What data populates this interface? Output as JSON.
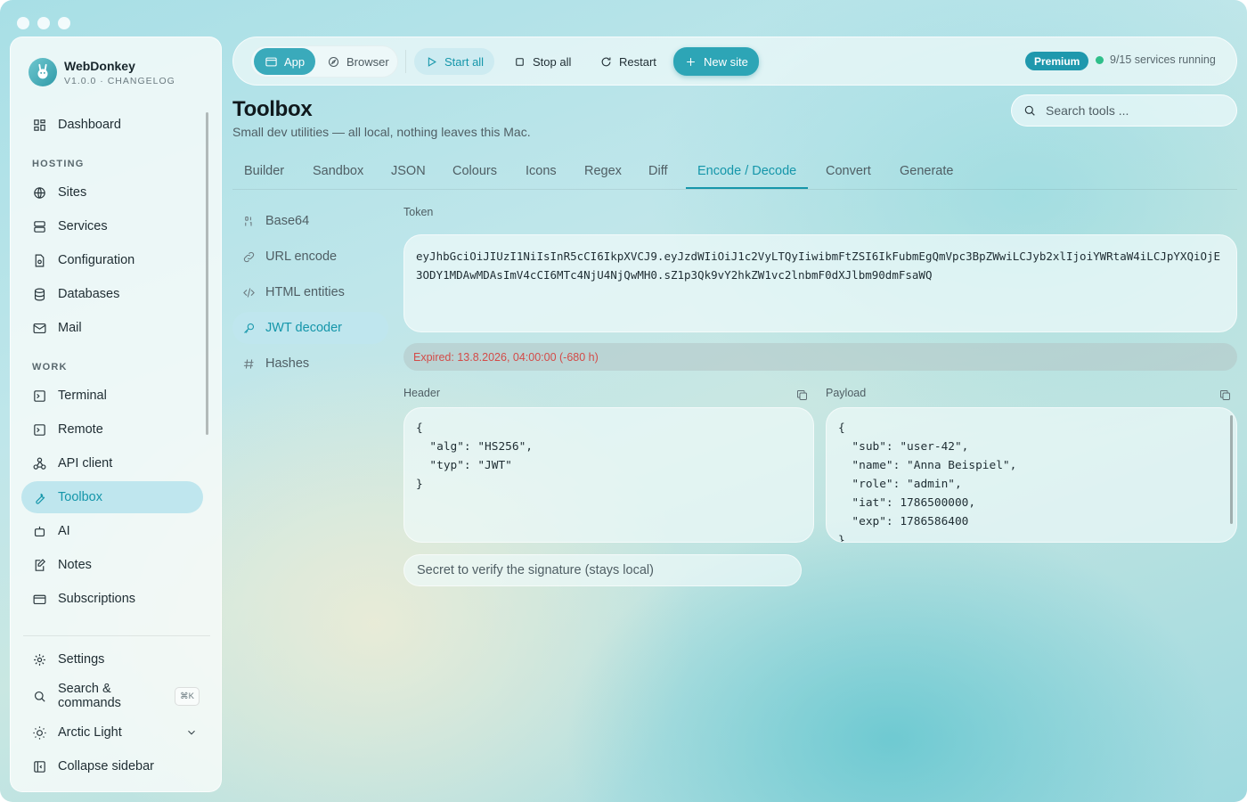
{
  "app": {
    "name": "WebDonkey",
    "version_line": "V1.0.0 · CHANGELOG"
  },
  "sidebar": {
    "dashboard": "Dashboard",
    "hosting_label": "HOSTING",
    "hosting_items": [
      "Sites",
      "Services",
      "Configuration",
      "Databases",
      "Mail"
    ],
    "work_label": "WORK",
    "work_items": [
      "Terminal",
      "Remote",
      "API client",
      "Toolbox",
      "AI",
      "Notes",
      "Subscriptions"
    ],
    "active_item": "Toolbox",
    "settings": "Settings",
    "search_commands": "Search & commands",
    "search_shortcut": "⌘K",
    "theme": "Arctic Light",
    "collapse": "Collapse sidebar"
  },
  "topbar": {
    "app_label": "App",
    "browser_label": "Browser",
    "start_all": "Start all",
    "stop_all": "Stop all",
    "restart": "Restart",
    "new_site": "New site",
    "premium_badge": "Premium",
    "services_status": "9/15 services running"
  },
  "page": {
    "title": "Toolbox",
    "subtitle": "Small dev utilities — all local, nothing leaves this Mac.",
    "search_placeholder": "Search tools ..."
  },
  "tabs": [
    "Builder",
    "Sandbox",
    "JSON",
    "Colours",
    "Icons",
    "Regex",
    "Diff",
    "Encode / Decode",
    "Convert",
    "Generate"
  ],
  "active_tab": "Encode / Decode",
  "tools": [
    "Base64",
    "URL encode",
    "HTML entities",
    "JWT decoder",
    "Hashes"
  ],
  "active_tool": "JWT decoder",
  "jwt": {
    "token_label": "Token",
    "token_value": "eyJhbGciOiJIUzI1NiIsInR5cCI6IkpXVCJ9.eyJzdWIiOiJ1c2VyLTQyIiwibmFtZSI6IkFubmEgQmVpc3BpZWwiLCJyb2xlIjoiYWRtaW4iLCJpYXQiOjE3ODY1MDAwMDAsImV4cCI6MTc4NjU4NjQwMH0.sZ1p3Qk9vY2hkZW1vc2lnbmF0dXJlbm90dmFsaWQ",
    "expired_message": "Expired: 13.8.2026, 04:00:00 (-680 h)",
    "header_label": "Header",
    "header_json": "{\n  \"alg\": \"HS256\",\n  \"typ\": \"JWT\"\n}",
    "payload_label": "Payload",
    "payload_json": "{\n  \"sub\": \"user-42\",\n  \"name\": \"Anna Beispiel\",\n  \"role\": \"admin\",\n  \"iat\": 1786500000,\n  \"exp\": 1786586400\n}",
    "secret_placeholder": "Secret to verify the signature (stays local)"
  },
  "colors": {
    "accent": "#1596aa",
    "premium": "#1f98ad",
    "status_ok": "#2fbf8a",
    "error": "#d34b48"
  }
}
